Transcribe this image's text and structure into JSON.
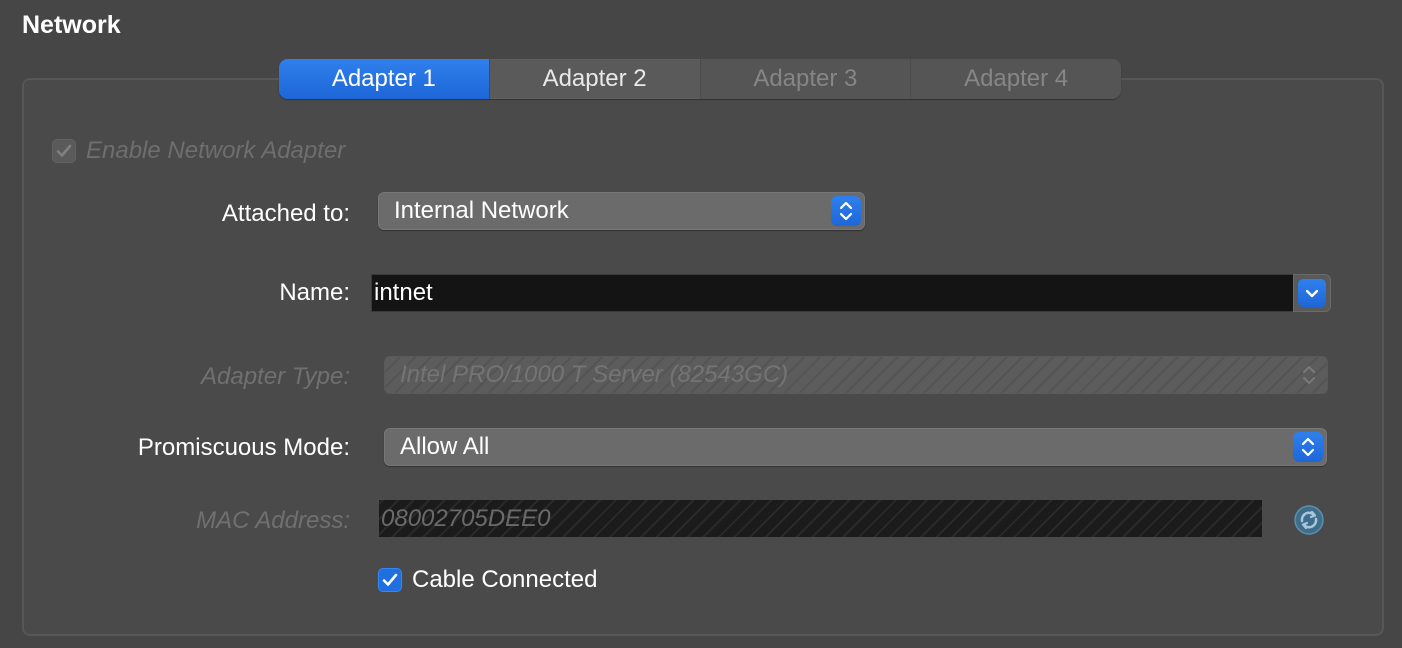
{
  "page": {
    "title": "Network"
  },
  "tabs": [
    {
      "label": "Adapter 1",
      "state": "selected"
    },
    {
      "label": "Adapter 2",
      "state": "normal"
    },
    {
      "label": "Adapter 3",
      "state": "disabled"
    },
    {
      "label": "Adapter 4",
      "state": "disabled"
    }
  ],
  "adapter": {
    "enable_label": "Enable Network Adapter",
    "enable_checked": true,
    "attached_to": {
      "label": "Attached to:",
      "value": "Internal Network"
    },
    "name": {
      "label": "Name:",
      "value": "intnet"
    },
    "adapter_type": {
      "label": "Adapter Type:",
      "value": "Intel PRO/1000 T Server (82543GC)"
    },
    "promiscuous_mode": {
      "label": "Promiscuous Mode:",
      "value": "Allow All"
    },
    "mac_address": {
      "label": "MAC Address:",
      "value": "08002705DEE0"
    },
    "cable_connected": {
      "label": "Cable Connected",
      "checked": true
    }
  },
  "colors": {
    "background": "#464646",
    "accent": "#1f6fe0",
    "disabled_text": "#707070"
  },
  "icons": {
    "stepper": "up-down-chevron-icon",
    "dropdown": "chevron-down-icon",
    "checkbox": "checkmark-icon",
    "refresh": "refresh-mac-icon"
  }
}
